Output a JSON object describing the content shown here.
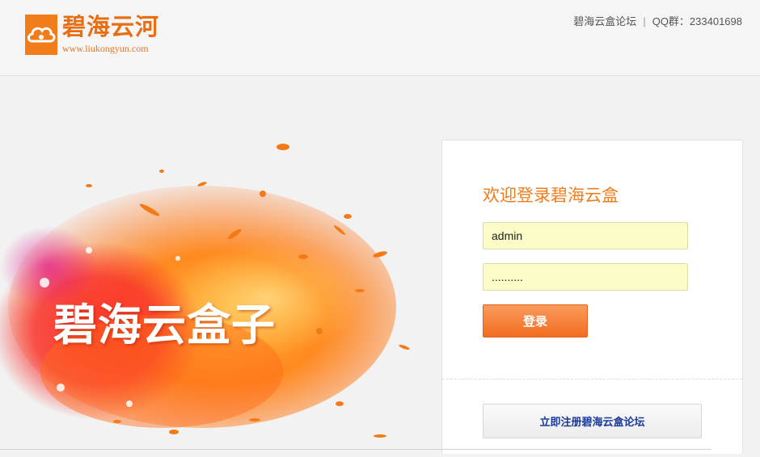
{
  "header": {
    "logo_title": "碧海云河",
    "logo_url": "www.liukongyun.com",
    "forum_link": "碧海云盒论坛",
    "separator": "|",
    "qq_group": "QQ群：233401698"
  },
  "splash": {
    "title": "碧海云盒子"
  },
  "login": {
    "welcome": "欢迎登录碧海云盒",
    "username_value": "admin",
    "password_value": "..........",
    "login_label": "登录",
    "register_label": "立即注册碧海云盒论坛"
  },
  "colors": {
    "accent": "#f07c1a",
    "input_bg": "#fbfcc8",
    "link_blue": "#1a3a9a"
  },
  "icons": {
    "logo": "cloud-logo-icon"
  }
}
